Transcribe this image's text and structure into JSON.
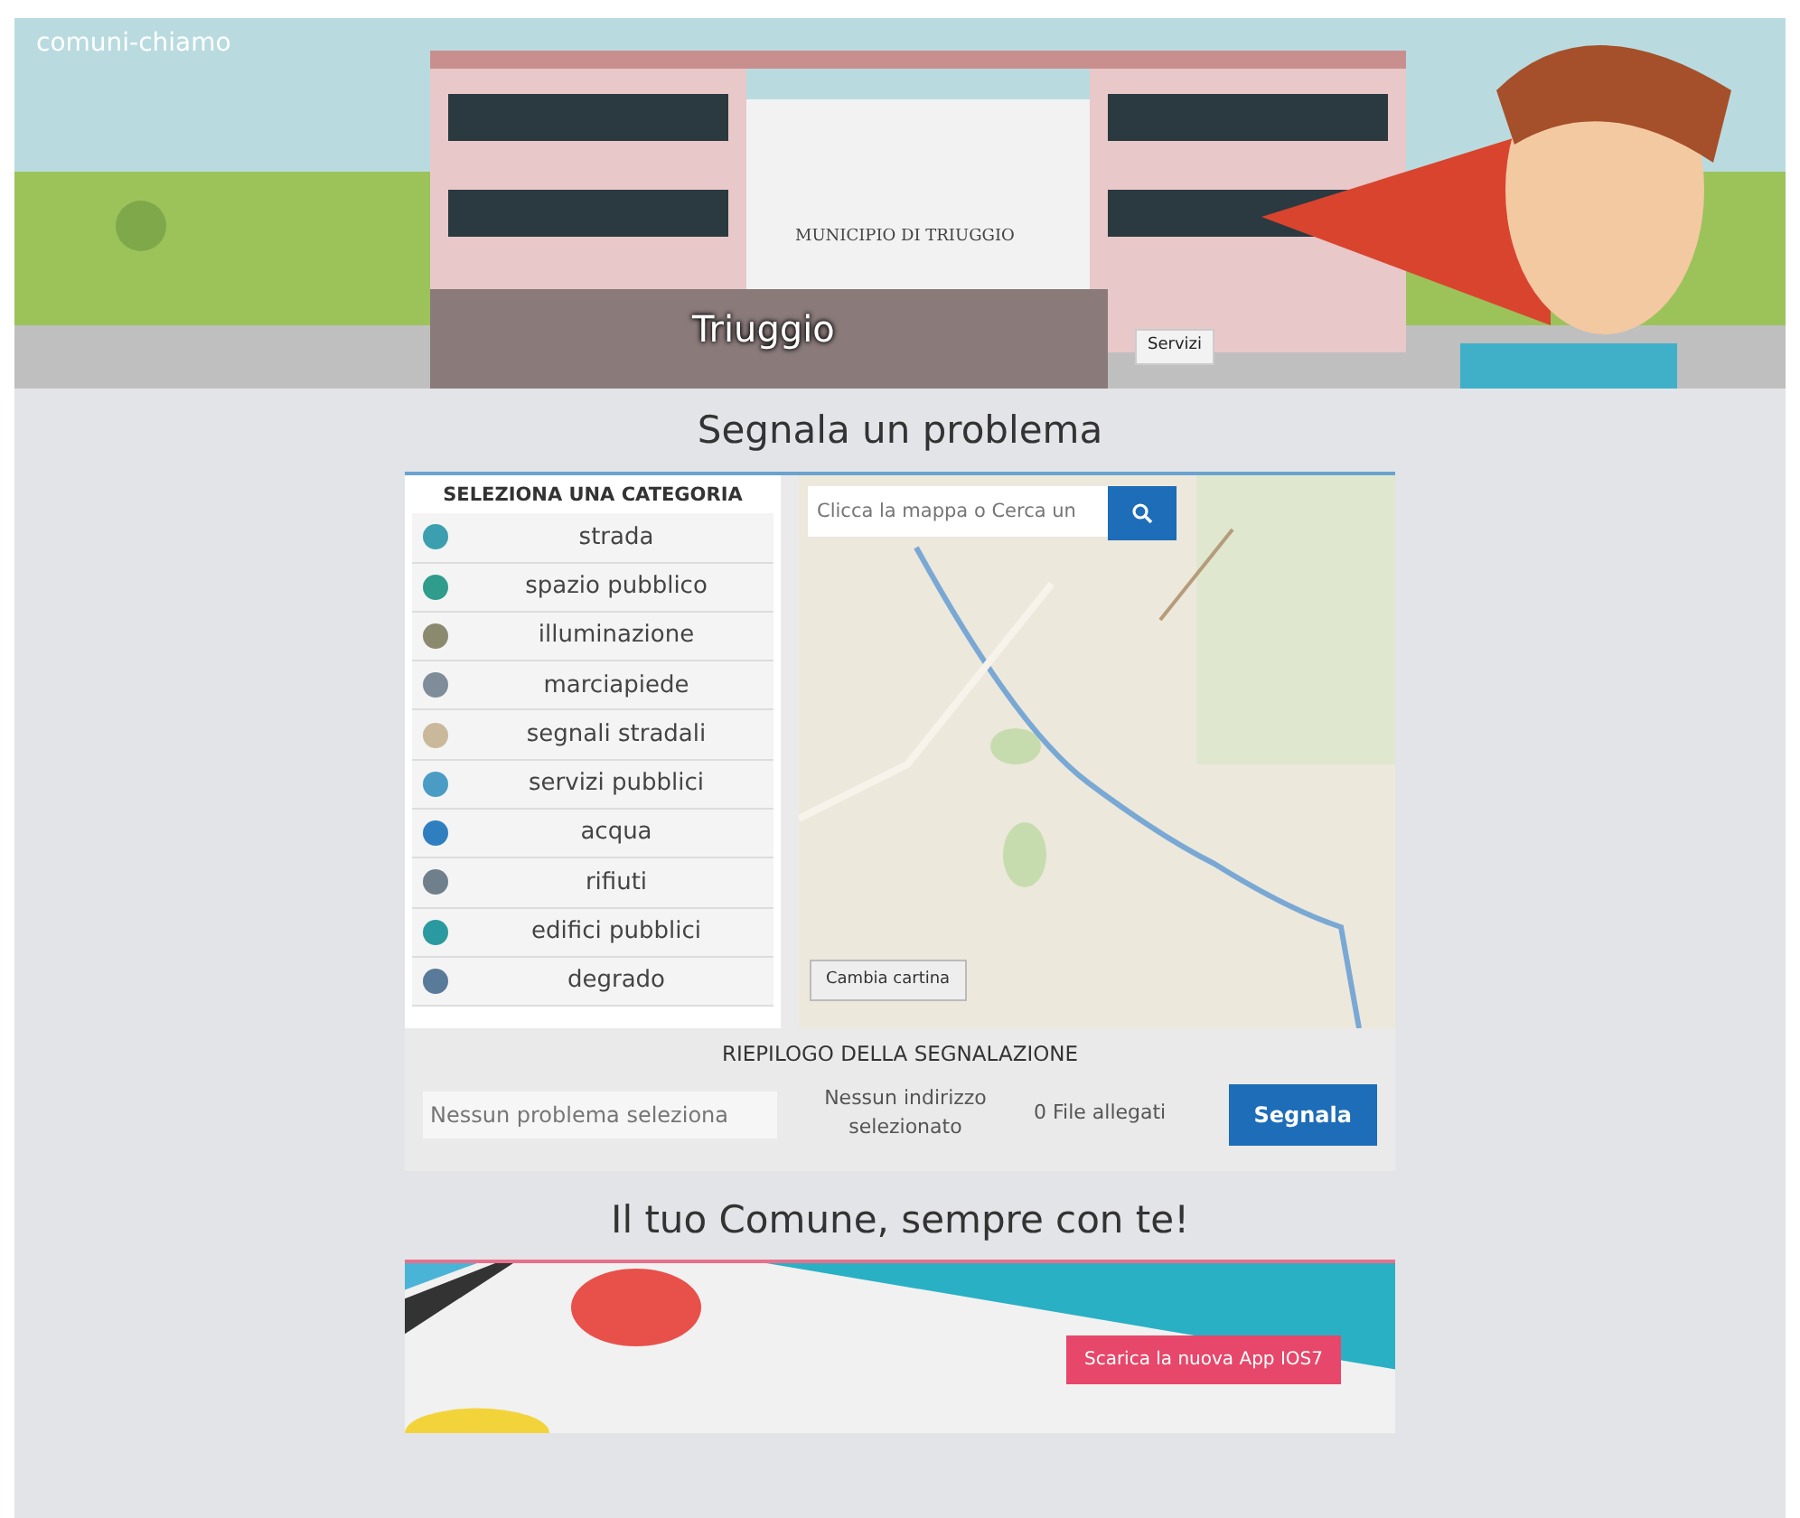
{
  "header": {
    "logo": "comuni-chiamo",
    "building_sign": "MUNICIPIO DI TRIUGGIO",
    "town": "Triuggio",
    "services_button": "Servizi"
  },
  "report": {
    "title": "Segnala un problema",
    "categories_heading": "SELEZIONA UNA CATEGORIA",
    "categories": [
      {
        "label": "strada",
        "color": "#3b9fb0"
      },
      {
        "label": "spazio pubblico",
        "color": "#2f9c8c"
      },
      {
        "label": "illuminazione",
        "color": "#8c8a6e"
      },
      {
        "label": "marciapiede",
        "color": "#7f8c99"
      },
      {
        "label": "segnali stradali",
        "color": "#c9b89a"
      },
      {
        "label": "servizi pubblici",
        "color": "#4a9cc4"
      },
      {
        "label": "acqua",
        "color": "#2f7fc0"
      },
      {
        "label": "rifiuti",
        "color": "#6f7f8c"
      },
      {
        "label": "edifici pubblici",
        "color": "#2b9aa0"
      },
      {
        "label": "degrado",
        "color": "#5a7a9a"
      }
    ],
    "map": {
      "search_placeholder": "Clicca la mappa o Cerca un",
      "change_map_button": "Cambia cartina"
    },
    "summary": {
      "title": "RIEPILOGO DELLA SEGNALAZIONE",
      "problem_placeholder": "Nessun problema seleziona",
      "address": "Nessun indirizzo selezionato",
      "files": "0 File allegati",
      "submit_button": "Segnala"
    }
  },
  "app_promo": {
    "title": "Il tuo Comune, sempre con te!",
    "download_button": "Scarica la nuova App IOS7"
  }
}
